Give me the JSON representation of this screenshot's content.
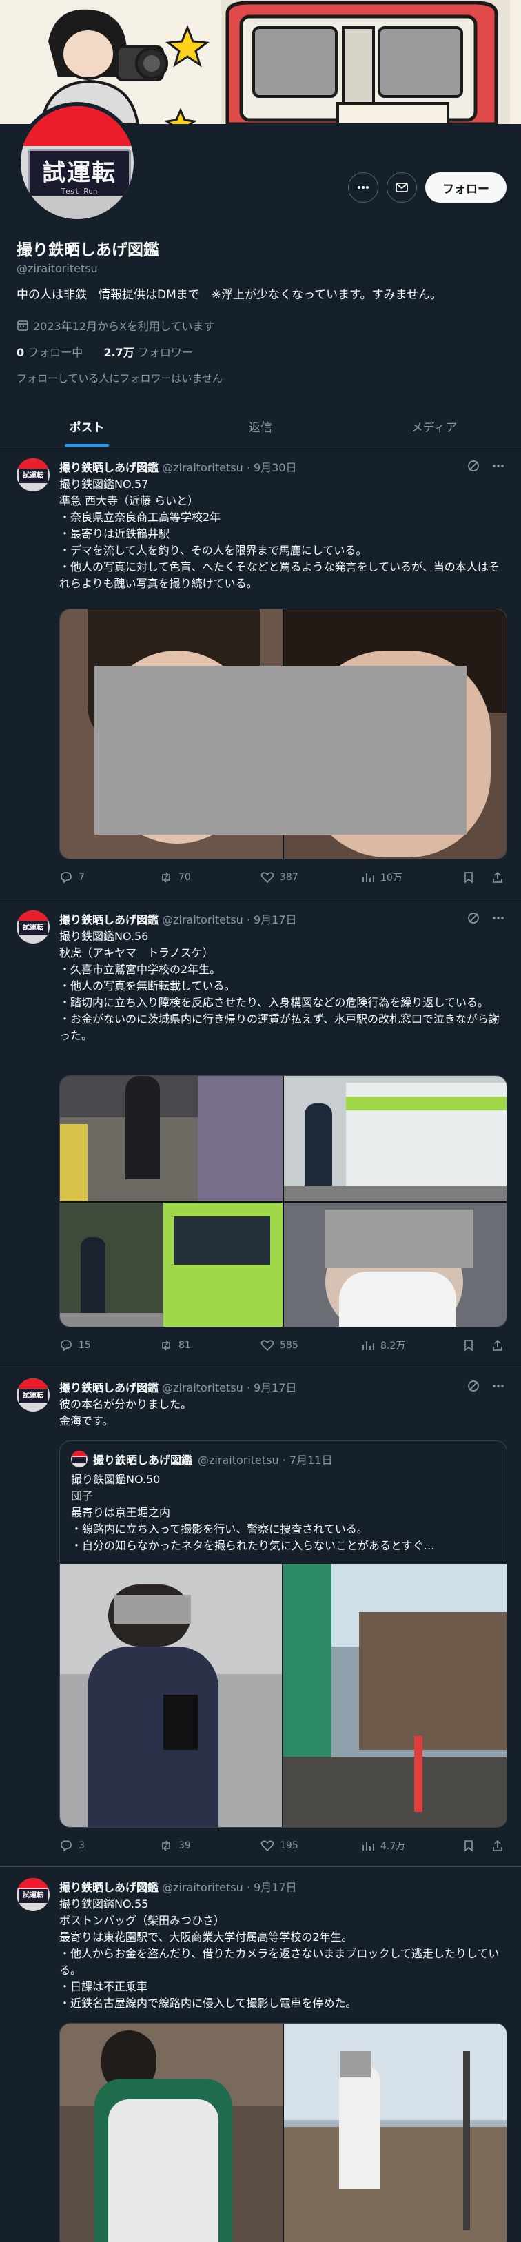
{
  "banner": {
    "icons": [
      "camera-icon",
      "spark-icon",
      "train-icon"
    ]
  },
  "avatar": {
    "sign_text": "試運転",
    "sign_sub": "Test Run"
  },
  "profile": {
    "name": "撮り鉄晒しあげ図鑑",
    "handle": "@ziraitoritetsu",
    "bio": "中の人は非鉄　情報提供はDMまで　※浮上が少なくなっています。すみません。",
    "joined": "2023年12月からXを利用しています",
    "following_count": "0",
    "following_label": "フォロー中",
    "followers_count": "2.7万",
    "followers_label": "フォロワー",
    "mutual_note": "フォローしている人にフォロワーはいません",
    "follow_label": "フォロー"
  },
  "tabs": [
    {
      "label": "ポスト",
      "active": true
    },
    {
      "label": "返信",
      "active": false
    },
    {
      "label": "メディア",
      "active": false
    }
  ],
  "tweets": [
    {
      "name": "撮り鉄晒しあげ図鑑",
      "handle": "@ziraitoritetsu",
      "date": "9月30日",
      "text": "撮り鉄図鑑NO.57\n準急 西大寺（近藤 らいと）\n・奈良県立奈良商工高等学校2年\n・最寄りは近鉄鶴井駅\n・デマを流して人を釣り、その人を限界まで馬鹿にしている。\n・他人の写真に対して色盲、へたくそなどと罵るような発言をしているが、当の本人はそれらよりも醜い写真を撮り続けている。",
      "replies": "7",
      "reposts": "70",
      "likes": "387",
      "views": "10万"
    },
    {
      "name": "撮り鉄晒しあげ図鑑",
      "handle": "@ziraitoritetsu",
      "date": "9月17日",
      "text": "撮り鉄図鑑NO.56\n秋虎（アキヤマ　トラノスケ）\n・久喜市立鷲宮中学校の2年生。\n・他人の写真を無断転載している。\n・踏切内に立ち入り障検を反応させたり、入身構図などの危険行為を繰り返している。\n・お金がないのに茨城県内に行き帰りの運賃が払えず、水戸駅の改札窓口で泣きながら謝った。",
      "replies": "15",
      "reposts": "81",
      "likes": "585",
      "views": "8.2万"
    },
    {
      "name": "撮り鉄晒しあげ図鑑",
      "handle": "@ziraitoritetsu",
      "date": "9月17日",
      "text": "彼の本名が分かりました。\n金海です。",
      "quote": {
        "name": "撮り鉄晒しあげ図鑑",
        "handle": "@ziraitoritetsu",
        "date": "7月11日",
        "text": "撮り鉄図鑑NO.50\n団子\n最寄りは京王堀之内\n・線路内に立ち入って撮影を行い、警察に捜査されている。\n・自分の知らなかったネタを撮られたり気に入らないことがあるとすぐ…"
      },
      "replies": "3",
      "reposts": "39",
      "likes": "195",
      "views": "4.7万"
    },
    {
      "name": "撮り鉄晒しあげ図鑑",
      "handle": "@ziraitoritetsu",
      "date": "9月17日",
      "text": "撮り鉄図鑑NO.55\nボストンバッグ（柴田みつひさ）\n最寄りは東花園駅で、大阪商業大学付属高等学校の2年生。\n・他人からお金を盗んだり、借りたカメラを返さないままブロックして逃走したりしている。\n・日課は不正乗車\n・近鉄名古屋線内で線路内に侵入して撮影し電車を停めた。"
    }
  ],
  "colors": {
    "background": "#15202b",
    "text": "#f7f9f9",
    "muted": "#8b98a5",
    "border": "#38444d",
    "accent": "#1d9bf0",
    "train_green": "#9fd848"
  }
}
